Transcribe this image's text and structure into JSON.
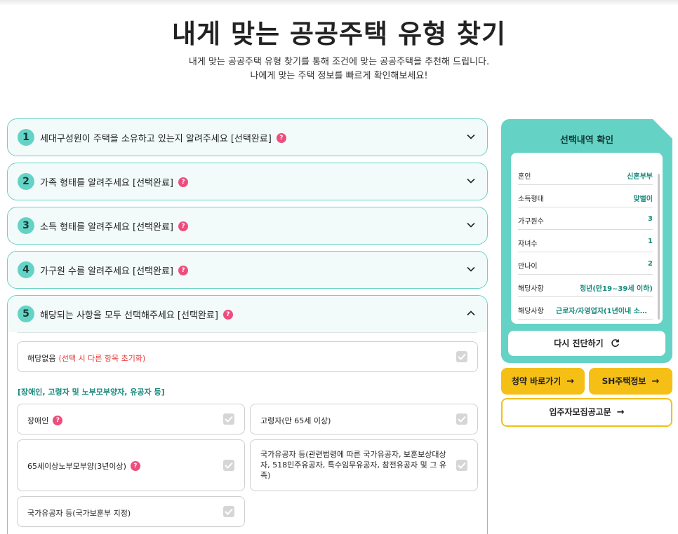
{
  "header": {
    "title": "내게 맞는 공공주택 유형 찾기",
    "subtitle_line1": "내게 맞는 공공주택 유형 찾기를 통해 조건에 맞는 공공주택을 추천해 드립니다.",
    "subtitle_line2": "나에게 맞는 주택 정보를 빠르게 확인해보세요!"
  },
  "steps": [
    {
      "num": "1",
      "title": "세대구성원이 주택을 소유하고 있는지 알려주세요 [선택완료]",
      "expanded": false
    },
    {
      "num": "2",
      "title": "가족 형태를 알려주세요 [선택완료]",
      "expanded": false
    },
    {
      "num": "3",
      "title": "소득 형태를 알려주세요 [선택완료]",
      "expanded": false
    },
    {
      "num": "4",
      "title": "가구원 수를 알려주세요 [선택완료]",
      "expanded": false
    },
    {
      "num": "5",
      "title": "해당되는 사항을 모두 선택해주세요 [선택완료]",
      "expanded": true
    }
  ],
  "step5": {
    "none_option": {
      "label": "해당없음",
      "warning": "(선택 시 다른 항목 초기화)"
    },
    "group_label": "[장애인, 고령자 및 노부모부양자, 유공자 등]",
    "options": [
      {
        "label": "장애인",
        "help": true
      },
      {
        "label": "고령자(만 65세 이상)",
        "help": false
      },
      {
        "label": "65세이상노부모부양(3년이상)",
        "help": true
      },
      {
        "label": "국가유공자 등(관련법령에 따른 국가유공자, 보훈보상대상자, 518민주유공자, 특수임무유공자, 참전유공자 및 그 유족)",
        "help": false
      },
      {
        "label": "국가유공자 등(국가보훈부 지정)",
        "help": false
      }
    ]
  },
  "help_glyph": "?",
  "summary": {
    "title": "선택내역 확인",
    "rows": [
      {
        "key": "혼인",
        "value": "신혼부부"
      },
      {
        "key": "소득형태",
        "value": "맞벌이"
      },
      {
        "key": "가구원수",
        "value": "3"
      },
      {
        "key": "자녀수",
        "value": "1"
      },
      {
        "key": "만나이",
        "value": "2"
      },
      {
        "key": "해당사항",
        "value": "청년(만19~39세 이하)"
      },
      {
        "key": "해당사항",
        "value": "근로자/자영업자(1년이내 소득..."
      }
    ],
    "retry_label": "다시 진단하기"
  },
  "actions": {
    "subscription_label": "청약 바로가기",
    "sh_label": "SH주택정보",
    "notice_label": "입주자모집공고문",
    "arrow": "→"
  },
  "colors": {
    "teal": "#64d3c6",
    "teal_dark": "#16897d",
    "yellow": "#f5bf16",
    "pink": "#ee4e7d",
    "red": "#e83a3a"
  }
}
